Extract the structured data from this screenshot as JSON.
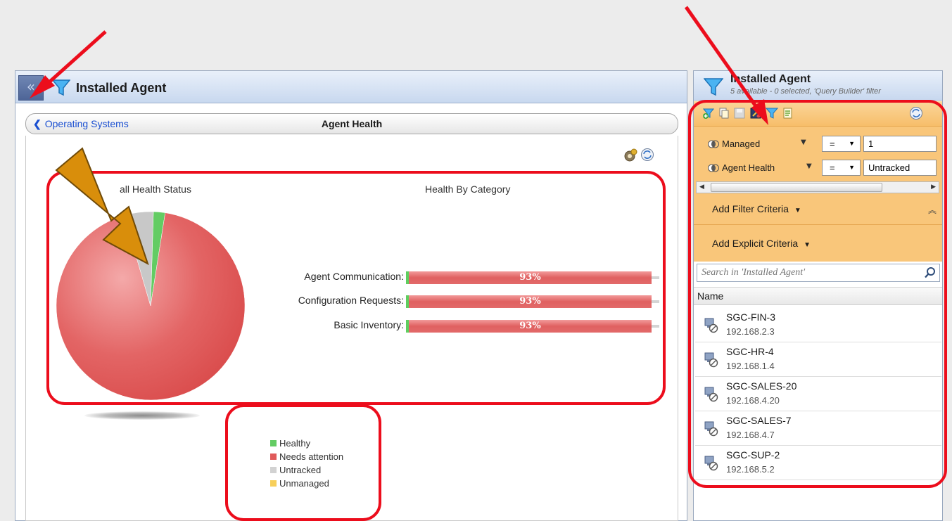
{
  "left_panel": {
    "title": "Installed Agent",
    "collapse_glyph": "«",
    "breadcrumb": {
      "back_label": "Operating Systems",
      "current": "Agent Health"
    }
  },
  "pie_chart": {
    "title": "all Health Status"
  },
  "bar_chart": {
    "title": "Health By Category"
  },
  "chart_data": [
    {
      "type": "pie",
      "title": "all Health Status",
      "slices": [
        {
          "name": "Needs attention",
          "value": 93,
          "color": "#e05a5a"
        },
        {
          "name": "Untracked",
          "value": 5,
          "color": "#c8c8c8"
        },
        {
          "name": "Healthy",
          "value": 2,
          "color": "#63cc63"
        }
      ]
    },
    {
      "type": "bar",
      "title": "Health By Category",
      "categories": [
        "Agent Communication:",
        "Configuration Requests:",
        "Basic Inventory:"
      ],
      "series": [
        {
          "name": "Healthy",
          "values": [
            1,
            1,
            1
          ],
          "color": "#5fce5f"
        },
        {
          "name": "Needs attention",
          "values": [
            93,
            93,
            93
          ],
          "color": "#e06060"
        },
        {
          "name": "Untracked",
          "values": [
            5,
            5,
            5
          ],
          "color": "#d4d4d4"
        }
      ],
      "data_labels": [
        "93%",
        "93%",
        "93%"
      ]
    }
  ],
  "legend": [
    {
      "label": "Healthy",
      "color": "#63cc63"
    },
    {
      "label": "Needs attention",
      "color": "#e05a5a"
    },
    {
      "label": "Untracked",
      "color": "#d2d2d2"
    },
    {
      "label": "Unmanaged",
      "color": "#f7cf5a"
    }
  ],
  "right_panel": {
    "title": "Installed Agent",
    "subtitle": "5 available - 0 selected, 'Query Builder' filter",
    "criteria": [
      {
        "field": "Managed",
        "operator": "=",
        "value": "1"
      },
      {
        "field": "Agent Health",
        "operator": "=",
        "value": "Untracked"
      }
    ],
    "add_filter_label": "Add Filter Criteria",
    "add_explicit_label": "Add Explicit Criteria",
    "search_placeholder": "Search in 'Installed Agent'",
    "column_header": "Name",
    "agents": [
      {
        "name": "SGC-FIN-3",
        "ip": "192.168.2.3"
      },
      {
        "name": "SGC-HR-4",
        "ip": "192.168.1.4"
      },
      {
        "name": "SGC-SALES-20",
        "ip": "192.168.4.20"
      },
      {
        "name": "SGC-SALES-7",
        "ip": "192.168.4.7"
      },
      {
        "name": "SGC-SUP-2",
        "ip": "192.168.5.2"
      }
    ]
  },
  "colors": {
    "annotation_red": "#ec0d1c",
    "annotation_orange": "#d98e0b",
    "filter_bg": "#f9c67a"
  }
}
